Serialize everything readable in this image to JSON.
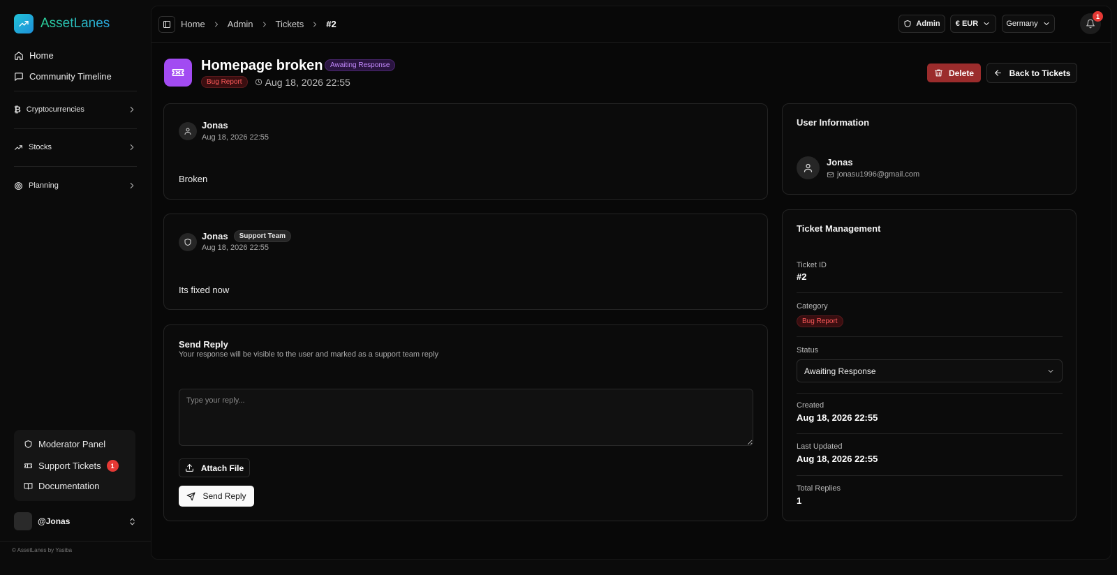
{
  "app": {
    "name": "AssetLanes"
  },
  "sidebar": {
    "nav": [
      {
        "label": "Home"
      },
      {
        "label": "Community Timeline"
      }
    ],
    "groups": [
      {
        "label": "Cryptocurrencies"
      },
      {
        "label": "Stocks"
      },
      {
        "label": "Planning"
      }
    ],
    "bottom": [
      {
        "label": "Moderator Panel"
      },
      {
        "label": "Support Tickets",
        "badge": "1"
      },
      {
        "label": "Documentation"
      }
    ],
    "user": {
      "handle": "@Jonas"
    },
    "footer": "© AssetLanes by Yasiba"
  },
  "topbar": {
    "breadcrumb": [
      "Home",
      "Admin",
      "Tickets",
      "#2"
    ],
    "admin_label": "Admin",
    "currency": "€ EUR",
    "country": "Germany",
    "notifications": "1"
  },
  "ticket": {
    "title": "Homepage broken",
    "status": "Awaiting Response",
    "category": "Bug Report",
    "date": "Aug 18, 2026 22:55",
    "delete_label": "Delete",
    "back_label": "Back to Tickets"
  },
  "messages": [
    {
      "author": "Jonas",
      "date": "Aug 18, 2026 22:55",
      "body": "Broken"
    },
    {
      "author": "Jonas",
      "role": "Support Team",
      "date": "Aug 18, 2026 22:55",
      "body": "Its fixed now"
    }
  ],
  "reply": {
    "title": "Send Reply",
    "subtitle": "Your response will be visible to the user and marked as a support team reply",
    "placeholder": "Type your reply...",
    "value": "",
    "attach_label": "Attach File",
    "send_label": "Send Reply"
  },
  "user_info": {
    "title": "User Information",
    "name": "Jonas",
    "email": "jonasu1996@gmail.com"
  },
  "management": {
    "title": "Ticket Management",
    "id_label": "Ticket ID",
    "id_value": "#2",
    "category_label": "Category",
    "category_value": "Bug Report",
    "status_label": "Status",
    "status_value": "Awaiting Response",
    "created_label": "Created",
    "created_value": "Aug 18, 2026 22:55",
    "updated_label": "Last Updated",
    "updated_value": "Aug 18, 2026 22:55",
    "replies_label": "Total Replies",
    "replies_value": "1"
  },
  "colors": {
    "accent_purple": "#a24bf2",
    "danger": "#9b2c2c",
    "badge_red": "#e53935"
  }
}
